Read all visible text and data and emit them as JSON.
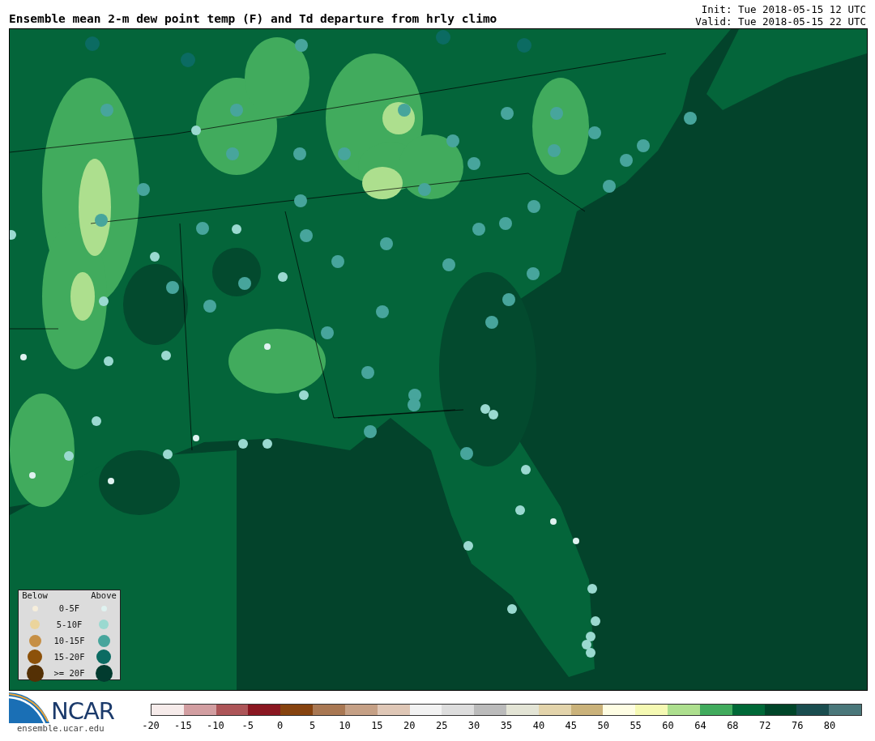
{
  "title": "Ensemble mean 2-m dew point temp (F) and Td departure from hrly climo",
  "init": "Init: Tue 2018-05-15 12 UTC",
  "valid": "Valid: Tue 2018-05-15 22 UTC",
  "legend": {
    "below_heading": "Below",
    "above_heading": "Above",
    "rows": [
      {
        "label": "0-5F",
        "below": {
          "color": "#f6eedb"
        },
        "above": {
          "color": "#dff2f0"
        }
      },
      {
        "label": "5-10F",
        "below": {
          "color": "#ebd49c"
        },
        "above": {
          "color": "#9ad9d0"
        }
      },
      {
        "label": "10-15F",
        "below": {
          "color": "#c68f45"
        },
        "above": {
          "color": "#47a59c"
        }
      },
      {
        "label": "15-20F",
        "below": {
          "color": "#8c510a"
        },
        "above": {
          "color": "#0b6b62"
        }
      },
      {
        "label": ">= 20F",
        "below": {
          "color": "#543005"
        },
        "above": {
          "color": "#023b2f"
        }
      }
    ]
  },
  "logo": {
    "wordmark": "NCAR",
    "url": "ensemble.ucar.edu"
  },
  "colorbar": {
    "segments": [
      {
        "color": "#f6ebea"
      },
      {
        "color": "#d29ea1"
      },
      {
        "color": "#ad5558"
      },
      {
        "color": "#8a1721"
      },
      {
        "color": "#86430f"
      },
      {
        "color": "#a97853"
      },
      {
        "color": "#c5a085"
      },
      {
        "color": "#dfc7b6"
      },
      {
        "color": "#f2f2f2"
      },
      {
        "color": "#dddddd"
      },
      {
        "color": "#bbbbbb"
      },
      {
        "color": "#e3e4d5"
      },
      {
        "color": "#e3d4ab"
      },
      {
        "color": "#cab27a"
      },
      {
        "color": "#fefde3"
      },
      {
        "color": "#f5f9b3"
      },
      {
        "color": "#addf8e"
      },
      {
        "color": "#41ab5d"
      },
      {
        "color": "#006837"
      },
      {
        "color": "#004529"
      },
      {
        "color": "#1a4d4f"
      },
      {
        "color": "#4a777a"
      }
    ],
    "ticks": [
      "-20",
      "-15",
      "-10",
      "-5",
      "0",
      "5",
      "10",
      "15",
      "20",
      "25",
      "30",
      "35",
      "40",
      "45",
      "50",
      "55",
      "60",
      "64",
      "68",
      "72",
      "76",
      "80"
    ]
  }
}
